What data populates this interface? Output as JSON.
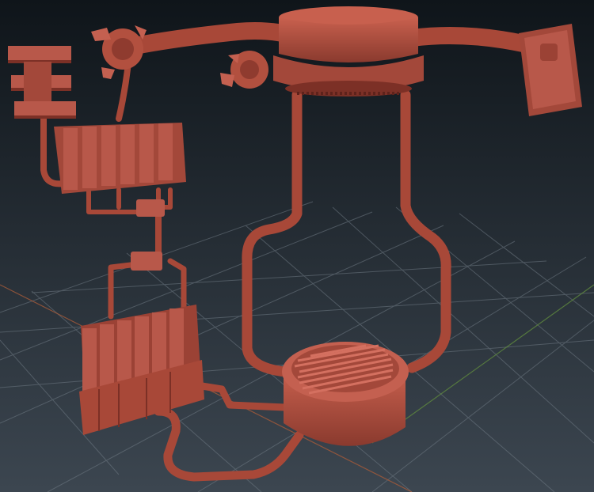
{
  "viewport": {
    "kind": "3d-modeling-viewport",
    "background_top": "#0f151a",
    "background_bottom": "#3c4650",
    "grid_color": "#6f7a84",
    "x_axis_color": "#a55a3a",
    "y_axis_color": "#5f8a3e"
  },
  "model": {
    "material_color": "#b2503f",
    "material_highlight": "#d06a58",
    "material_shadow": "#7c3026",
    "parts": [
      "top-hub",
      "left-arm-pipe",
      "right-arm-pipe",
      "right-wall-bracket",
      "left-clamp-upper",
      "left-clamp-lower",
      "left-coupler-stack",
      "upper-radiator-block",
      "mid-manifold-upper",
      "mid-manifold-lower",
      "lower-radiator-block",
      "floor-grate-drum",
      "left-vertical-pipe",
      "right-vertical-pipe",
      "bottom-loop-pipe",
      "connector-pipe"
    ]
  }
}
